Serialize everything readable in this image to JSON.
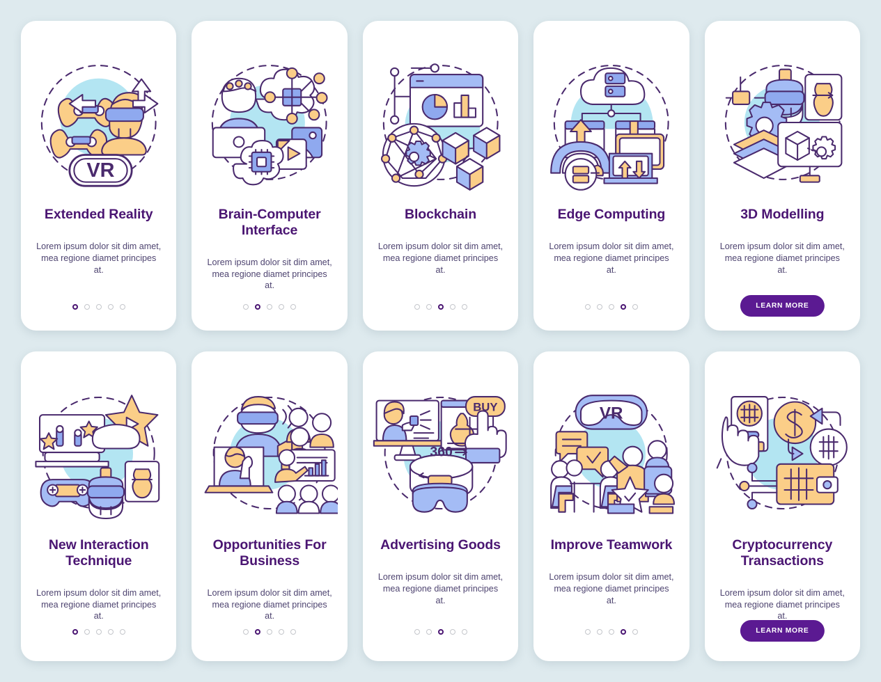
{
  "page": {
    "background_color": "#deeaee",
    "card_background": "#ffffff",
    "title_color": "#4a1572",
    "body_color": "#4e4470",
    "accent_color": "#5b1a92",
    "dot_active_color": "#4a1572",
    "dot_inactive_color": "#c4c6cb",
    "illustration_palette": {
      "outline": "#4a2a6d",
      "blue": "#a4bcf5",
      "blue_dark": "#8fa9ef",
      "orange": "#fbce88",
      "cyan_backdrop": "#b3e5f2",
      "white": "#ffffff"
    }
  },
  "body_text": "Lorem ipsum dolor sit dim amet, mea regione diamet principes at.",
  "learn_more_label": "LEARN MORE",
  "rows": [
    {
      "cards": [
        {
          "title": "Extended Reality",
          "body": "Lorem ipsum dolor sit dim amet, mea regione diamet principes at.",
          "illustration": "extended-reality-illustration",
          "illustration_text": "VR",
          "dots": {
            "count": 5,
            "active_index": 0
          },
          "has_learn_more": false
        },
        {
          "title": "Brain-Computer Interface",
          "body": "Lorem ipsum dolor sit dim amet, mea regione diamet principes at.",
          "illustration": "brain-computer-interface-illustration",
          "illustration_text": "",
          "dots": {
            "count": 5,
            "active_index": 1
          },
          "has_learn_more": false
        },
        {
          "title": "Blockchain",
          "body": "Lorem ipsum dolor sit dim amet, mea regione diamet principes at.",
          "illustration": "blockchain-illustration",
          "illustration_text": "",
          "dots": {
            "count": 5,
            "active_index": 2
          },
          "has_learn_more": false
        },
        {
          "title": "Edge Computing",
          "body": "Lorem ipsum dolor sit dim amet, mea regione diamet principes at.",
          "illustration": "edge-computing-illustration",
          "illustration_text": "",
          "dots": {
            "count": 5,
            "active_index": 3
          },
          "has_learn_more": false
        },
        {
          "title": "3D Modelling",
          "body": "Lorem ipsum dolor sit dim amet, mea regione diamet principes at.",
          "illustration": "3d-modelling-illustration",
          "illustration_text": "",
          "dots": {
            "count": 0,
            "active_index": -1
          },
          "has_learn_more": true,
          "learn_more_label": "LEARN MORE"
        }
      ]
    },
    {
      "cards": [
        {
          "title": "New Interaction Technique",
          "body": "Lorem ipsum dolor sit dim amet, mea regione diamet principes at.",
          "illustration": "new-interaction-technique-illustration",
          "illustration_text": "",
          "dots": {
            "count": 5,
            "active_index": 0
          },
          "has_learn_more": false
        },
        {
          "title": "Opportunities For Business",
          "body": "Lorem ipsum dolor sit dim amet, mea regione diamet principes at.",
          "illustration": "opportunities-for-business-illustration",
          "illustration_text": "",
          "dots": {
            "count": 5,
            "active_index": 1
          },
          "has_learn_more": false
        },
        {
          "title": "Advertising Goods",
          "body": "Lorem ipsum dolor sit dim amet, mea regione diamet principes at.",
          "illustration": "advertising-goods-illustration",
          "illustration_text": "BUY / 360",
          "dots": {
            "count": 5,
            "active_index": 2
          },
          "has_learn_more": false
        },
        {
          "title": "Improve Teamwork",
          "body": "Lorem ipsum dolor sit dim amet, mea regione diamet principes at.",
          "illustration": "improve-teamwork-illustration",
          "illustration_text": "VR",
          "dots": {
            "count": 5,
            "active_index": 3
          },
          "has_learn_more": false
        },
        {
          "title": "Cryptocurrency Transactions",
          "body": "Lorem ipsum dolor sit dim amet, mea regione diamet principes at.",
          "illustration": "cryptocurrency-transactions-illustration",
          "illustration_text": "",
          "dots": {
            "count": 0,
            "active_index": -1
          },
          "has_learn_more": true,
          "learn_more_label": "LEARN MORE"
        }
      ]
    }
  ]
}
